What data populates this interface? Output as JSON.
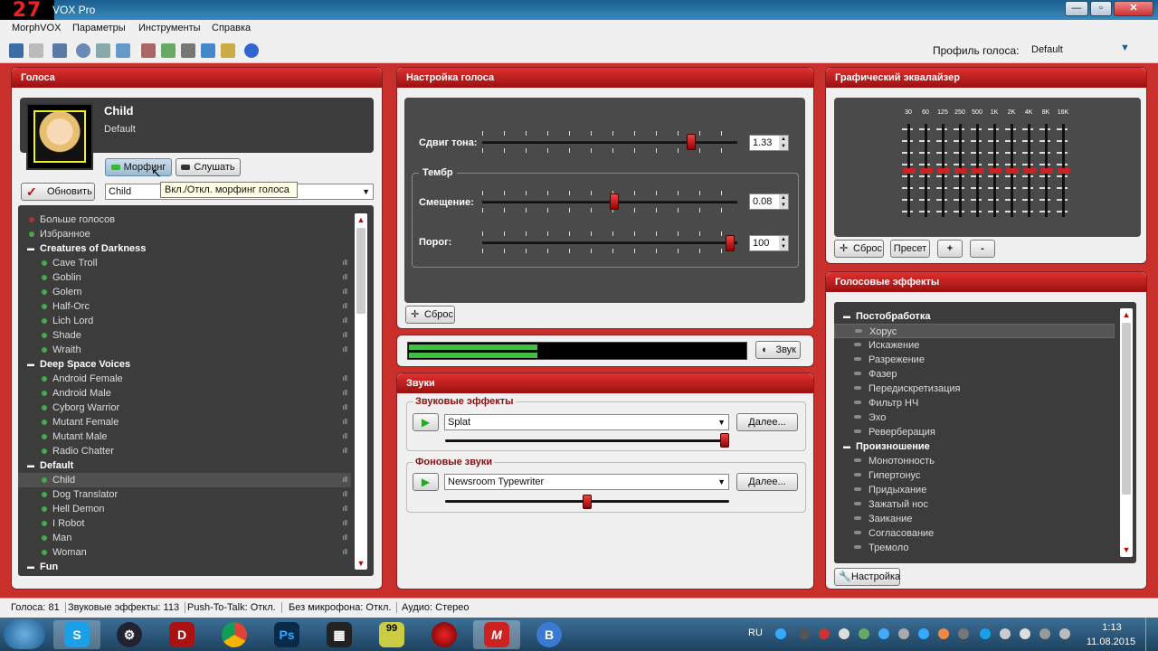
{
  "window": {
    "logo": "27",
    "title": "VOX Pro",
    "minimize": "—",
    "maximize": "▫",
    "close": "✕"
  },
  "menu": [
    "MorphVOX",
    "Параметры",
    "Инструменты",
    "Справка"
  ],
  "profile": {
    "label": "Профиль голоса:",
    "value": "Default"
  },
  "voices": {
    "title": "Голоса",
    "current_name": "Child",
    "current_group": "Default",
    "morph_label": "Морфинг",
    "listen_label": "Слушать",
    "tooltip": "Вкл./Откл. морфинг голоса",
    "update_label": "Обновить",
    "selected_voice": "Child",
    "list": [
      {
        "t": "item",
        "label": "Больше голосов"
      },
      {
        "t": "item",
        "label": "Избранное"
      },
      {
        "t": "cat",
        "label": "Creatures of Darkness"
      },
      {
        "t": "voice",
        "label": "Cave Troll"
      },
      {
        "t": "voice",
        "label": "Goblin"
      },
      {
        "t": "voice",
        "label": "Golem"
      },
      {
        "t": "voice",
        "label": "Half-Orc"
      },
      {
        "t": "voice",
        "label": "Lich Lord"
      },
      {
        "t": "voice",
        "label": "Shade"
      },
      {
        "t": "voice",
        "label": "Wraith"
      },
      {
        "t": "cat",
        "label": "Deep Space Voices"
      },
      {
        "t": "voice",
        "label": "Android Female"
      },
      {
        "t": "voice",
        "label": "Android Male"
      },
      {
        "t": "voice",
        "label": "Cyborg Warrior"
      },
      {
        "t": "voice",
        "label": "Mutant Female"
      },
      {
        "t": "voice",
        "label": "Mutant Male"
      },
      {
        "t": "voice",
        "label": "Radio Chatter"
      },
      {
        "t": "cat",
        "label": "Default"
      },
      {
        "t": "voice",
        "label": "Child",
        "selected": true
      },
      {
        "t": "voice",
        "label": "Dog Translator"
      },
      {
        "t": "voice",
        "label": "Hell Demon"
      },
      {
        "t": "voice",
        "label": "I Robot"
      },
      {
        "t": "voice",
        "label": "Man"
      },
      {
        "t": "voice",
        "label": "Woman"
      },
      {
        "t": "cat",
        "label": "Fun"
      }
    ]
  },
  "tuning": {
    "title": "Настройка голоса",
    "pitch_label": "Сдвиг тона:",
    "pitch_value": "1.33",
    "pitch_pos": 0.83,
    "timbre_label": "Тембр",
    "shift_label": "Смещение:",
    "shift_value": "0.08",
    "shift_pos": 0.52,
    "threshold_label": "Порог:",
    "threshold_value": "100",
    "threshold_pos": 0.99,
    "reset_label": "Сброс"
  },
  "meter": {
    "level": 0.38,
    "sound_label": "Звук"
  },
  "sounds": {
    "title": "Звуки",
    "effects_label": "Звуковые эффекты",
    "effects_value": "Splat",
    "effects_more": "Далее...",
    "effects_volume": 1.0,
    "bg_label": "Фоновые звуки",
    "bg_value": "Newsroom Typewriter",
    "bg_more": "Далее...",
    "bg_volume": 0.5
  },
  "eq": {
    "title": "Графический эквалайзер",
    "bands": [
      "30",
      "60",
      "125",
      "250",
      "500",
      "1K",
      "2K",
      "4K",
      "8K",
      "16K"
    ],
    "reset_label": "Сброс",
    "preset_label": "Пресет",
    "plus": "+",
    "minus": "-"
  },
  "effects": {
    "title": "Голосовые эффекты",
    "list": [
      {
        "t": "cat",
        "label": "Постобработка"
      },
      {
        "t": "item",
        "label": "Хорус"
      },
      {
        "t": "item",
        "label": "Искажение"
      },
      {
        "t": "item",
        "label": "Разрежение"
      },
      {
        "t": "item",
        "label": "Фазер"
      },
      {
        "t": "item",
        "label": "Передискретизация"
      },
      {
        "t": "item",
        "label": "Фильтр НЧ"
      },
      {
        "t": "item",
        "label": "Эхо"
      },
      {
        "t": "item",
        "label": "Реверберация"
      },
      {
        "t": "cat",
        "label": "Произношение"
      },
      {
        "t": "item",
        "label": "Монотонность"
      },
      {
        "t": "item",
        "label": "Гипертонус"
      },
      {
        "t": "item",
        "label": "Придыхание"
      },
      {
        "t": "item",
        "label": "Зажатый нос"
      },
      {
        "t": "item",
        "label": "Заикание"
      },
      {
        "t": "item",
        "label": "Согласование"
      },
      {
        "t": "item",
        "label": "Тремоло"
      }
    ],
    "settings_label": "Настройка"
  },
  "status": [
    "Голоса: 81",
    "Звуковые эффекты: 113",
    "Push-To-Talk: Откл.",
    "Без микрофона: Откл.",
    "Аудио: Стерео"
  ],
  "taskbar": {
    "lang": "RU",
    "time": "1:13",
    "date": "11.08.2015",
    "badge": "99"
  },
  "colors": {
    "accent": "#c9302c",
    "dark_panel": "#4a4a4a",
    "meter_green": "#3fbf3f"
  }
}
